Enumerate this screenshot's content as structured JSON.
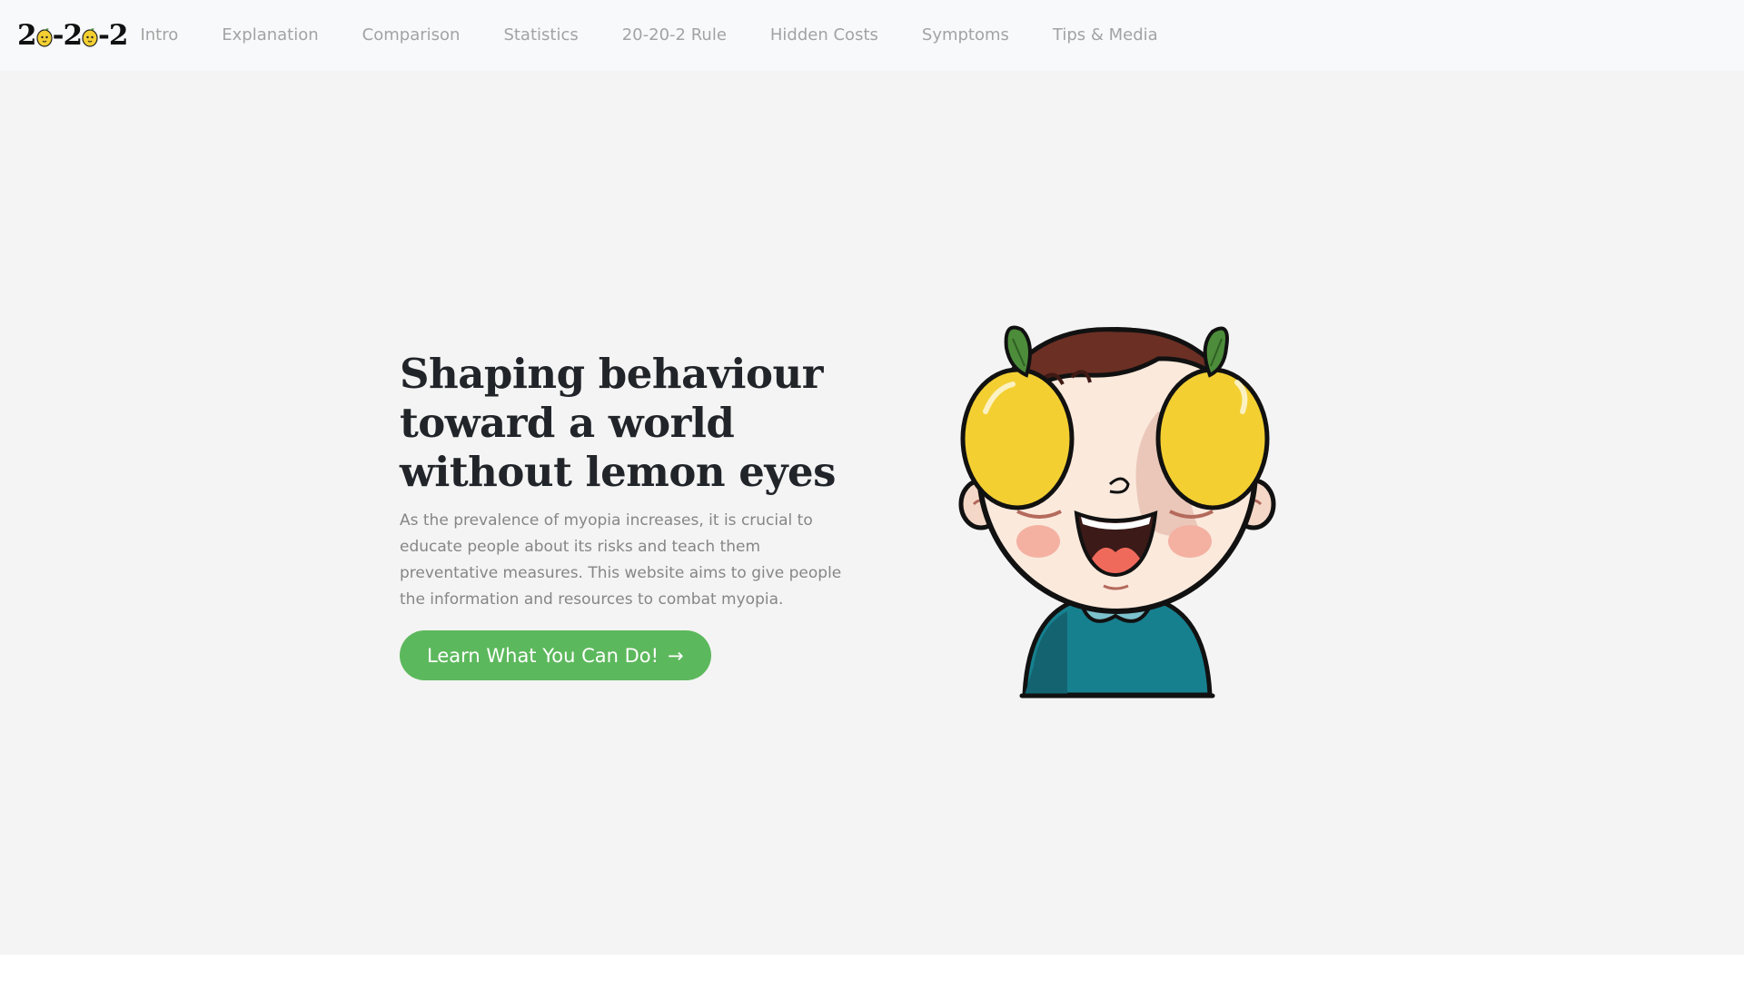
{
  "brand": {
    "part1": "2",
    "part2": "-2",
    "part3": "-2",
    "icon": "lemon-icon"
  },
  "nav": {
    "items": [
      {
        "label": "Intro"
      },
      {
        "label": "Explanation"
      },
      {
        "label": "Comparison"
      },
      {
        "label": "Statistics"
      },
      {
        "label": "20-20-2 Rule"
      },
      {
        "label": "Hidden Costs"
      },
      {
        "label": "Symptoms"
      },
      {
        "label": "Tips & Media"
      }
    ]
  },
  "hero": {
    "title": "Shaping behaviour toward a world without lemon eyes",
    "description": "As the prevalence of myopia increases, it is crucial to educate people about its risks and teach them preventative measures. This website aims to give people the information and resources to combat myopia.",
    "cta_label": "Learn What You Can Do!",
    "cta_arrow": "→",
    "illustration": "boy-with-lemon-eyes-illustration"
  },
  "colors": {
    "navbar_bg": "#f8f9fa",
    "hero_bg": "#f4f4f4",
    "nav_text": "#a3a3a3",
    "title_text": "#212529",
    "body_text": "#868686",
    "cta_bg": "#5cb85c",
    "lemon": "#f3cf32"
  }
}
